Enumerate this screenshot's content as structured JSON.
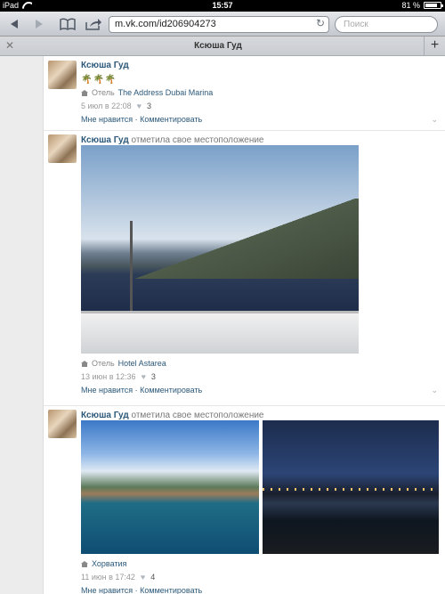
{
  "status_bar": {
    "device": "iPad",
    "time": "15:57",
    "battery": "81 %",
    "battery_level": 0.81
  },
  "browser": {
    "url": "m.vk.com/id206904273",
    "search_placeholder": "Поиск",
    "tab_title": "Ксюша Гуд"
  },
  "posts": [
    {
      "author": "Ксюша Гуд",
      "action": "",
      "text": "🌴🌴🌴",
      "place_label": "Отель",
      "place_name": "The Address Dubai Marina",
      "date": "5 июл в 22:08",
      "likes": "3",
      "actions": "Мне нравится · Комментировать"
    },
    {
      "author": "Ксюша Гуд",
      "action": "отметила свое местоположение",
      "place_label": "Отель",
      "place_name": "Hotel Astarea",
      "date": "13 июн в 12:36",
      "likes": "3",
      "actions": "Мне нравится · Комментировать"
    },
    {
      "author": "Ксюша Гуд",
      "action": "отметила свое местоположение",
      "place_label": "",
      "place_name": "Хорватия",
      "date": "11 июн в 17:42",
      "likes": "4",
      "actions": "Мне нравится · Комментировать"
    }
  ]
}
